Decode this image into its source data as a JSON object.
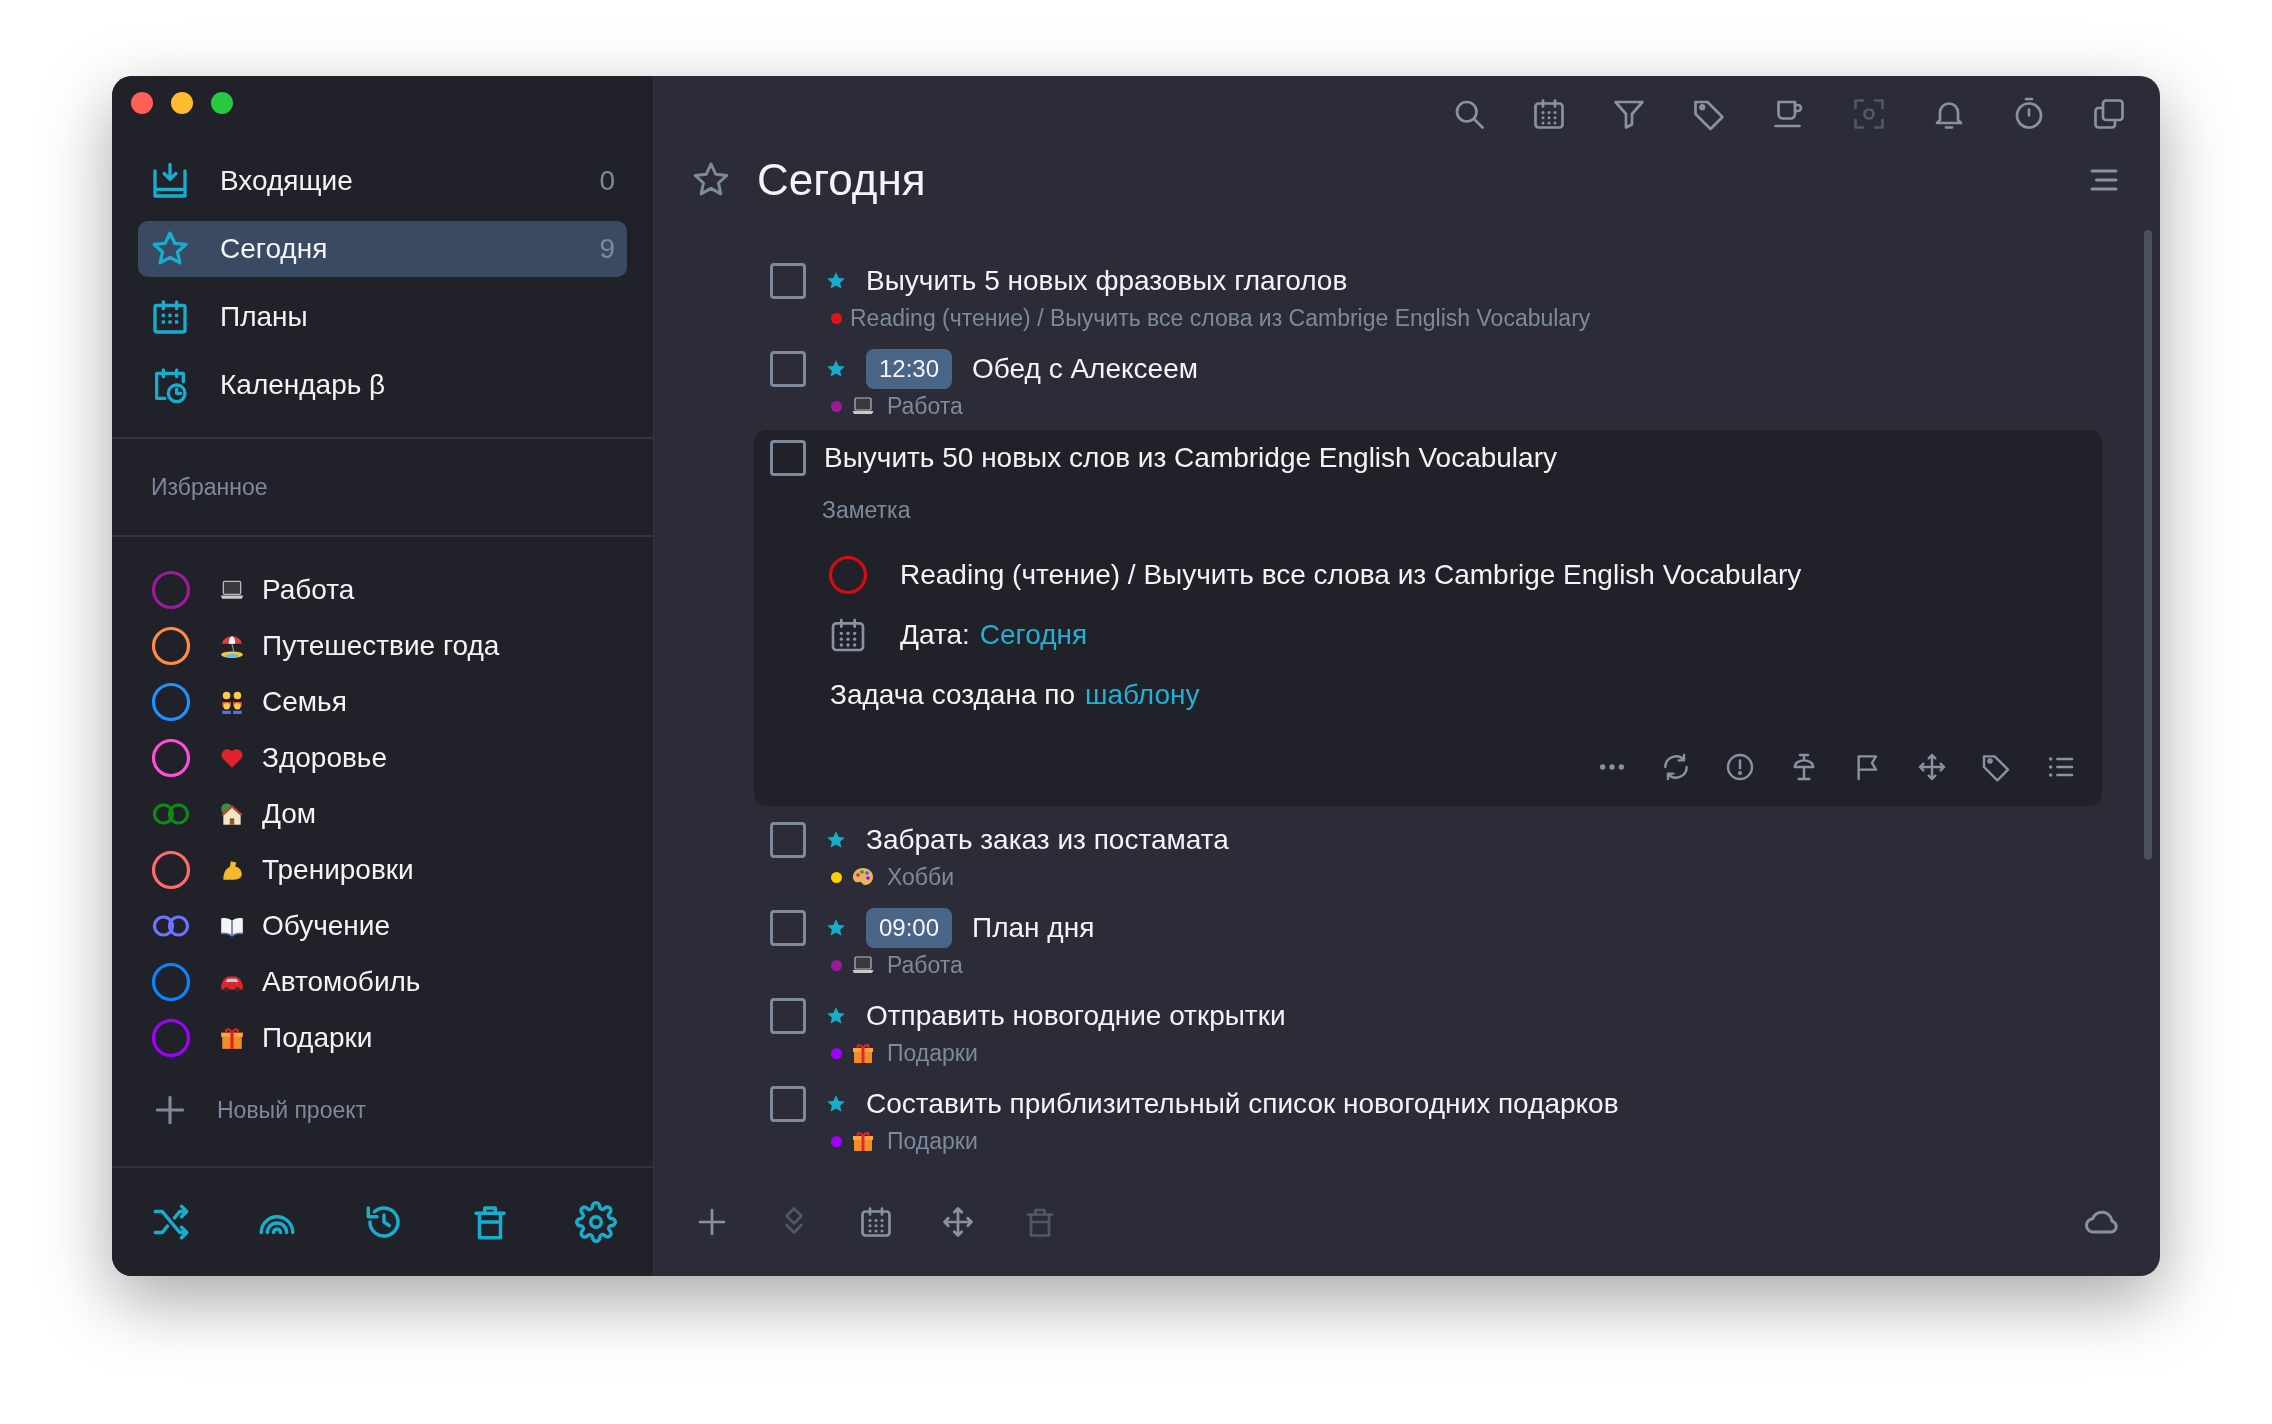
{
  "sidebar": {
    "nav": [
      {
        "kind": "inbox",
        "label": "Входящие",
        "count": "0",
        "selected": false
      },
      {
        "kind": "today",
        "label": "Сегодня",
        "count": "9",
        "selected": true
      },
      {
        "kind": "plans",
        "label": "Планы",
        "selected": false
      },
      {
        "kind": "calendar",
        "label": "Календарь β",
        "selected": false
      }
    ],
    "favorites_heading": "Избранное",
    "projects": [
      {
        "name": "Работа",
        "emoji": {
          "kind": "laptop"
        },
        "color": "#9c1a9b",
        "kind": "ring"
      },
      {
        "name": "Путешествие года",
        "emoji": {
          "kind": "beach"
        },
        "color": "#ff8c42",
        "kind": "ring"
      },
      {
        "name": "Семья",
        "emoji": {
          "kind": "family"
        },
        "color": "#1e90ff",
        "kind": "ring"
      },
      {
        "name": "Здоровье",
        "emoji": {
          "kind": "heart"
        },
        "color": "#ff4fd8",
        "kind": "ring"
      },
      {
        "name": "Дом",
        "emoji": {
          "kind": "house"
        },
        "color": "#0e8a16",
        "kind": "infinite"
      },
      {
        "name": "Тренировки",
        "emoji": {
          "kind": "arm"
        },
        "color": "#ff6a6a",
        "kind": "ring"
      },
      {
        "name": "Обучение",
        "emoji": {
          "kind": "book"
        },
        "color": "#6b73ff",
        "kind": "infinite"
      },
      {
        "name": "Автомобиль",
        "emoji": {
          "kind": "car"
        },
        "color": "#0a84ff",
        "kind": "ring"
      },
      {
        "name": "Подарки",
        "emoji": {
          "kind": "gift"
        },
        "color": "#a100ff",
        "kind": "ring"
      }
    ],
    "new_project": "Новый проект"
  },
  "toolbar": [
    {
      "kind": "search",
      "disabled": false
    },
    {
      "kind": "calendar",
      "disabled": false
    },
    {
      "kind": "filter",
      "disabled": false
    },
    {
      "kind": "tag",
      "disabled": false
    },
    {
      "kind": "cup",
      "disabled": false
    },
    {
      "kind": "focus",
      "disabled": true
    },
    {
      "kind": "bell",
      "disabled": false
    },
    {
      "kind": "timer",
      "disabled": false
    },
    {
      "kind": "copy",
      "disabled": false
    }
  ],
  "header": {
    "title": "Сегодня"
  },
  "tasks": [
    {
      "title": "Выучить 5 новых фразовых глаголов",
      "checked": false,
      "starred": true,
      "expanded": false,
      "project": {
        "name": "Reading (чтение) / Выучить все слова из Cambrige English Vocabulary",
        "color": "#e0131a"
      }
    },
    {
      "title": "Обед с Алексеем",
      "checked": false,
      "starred": true,
      "expanded": false,
      "time": "12:30",
      "project": {
        "name": "Работа",
        "color": "#9c1a9b",
        "emoji": {
          "kind": "laptop"
        }
      }
    },
    {
      "title": "Выучить 50 новых слов из Cambridge English Vocabulary",
      "checked": false,
      "starred": false,
      "expanded": true,
      "details": {
        "note_placeholder": "Заметка",
        "project": {
          "name": "Reading (чтение) / Выучить все слова из Cambrige English Vocabulary",
          "color": "#d90b12",
          "kind": "ring"
        },
        "date_label": "Дата:",
        "date_value": "Сегодня",
        "template_text": "Задача создана по",
        "template_link": "шаблону"
      }
    },
    {
      "title": "Забрать заказ из постамата",
      "checked": false,
      "starred": true,
      "expanded": false,
      "project": {
        "name": "Хобби",
        "color": "#ffcc00",
        "emoji": {
          "kind": "palette"
        }
      }
    },
    {
      "title": "План дня",
      "checked": false,
      "starred": true,
      "expanded": false,
      "time": "09:00",
      "project": {
        "name": "Работа",
        "color": "#9c1a9b",
        "emoji": {
          "kind": "laptop"
        }
      }
    },
    {
      "title": "Отправить новогодние открытки",
      "checked": false,
      "starred": true,
      "expanded": false,
      "project": {
        "name": "Подарки",
        "color": "#a100ff",
        "emoji": {
          "kind": "gift"
        }
      }
    },
    {
      "title": "Составить приблизительный список новогодних подарков",
      "checked": false,
      "starred": true,
      "expanded": false,
      "project": {
        "name": "Подарки",
        "color": "#a100ff",
        "emoji": {
          "kind": "gift"
        }
      }
    }
  ],
  "bottom_toolbar": [
    {
      "kind": "plus",
      "disabled": false
    },
    {
      "kind": "layers",
      "disabled": true
    },
    {
      "kind": "calendar",
      "disabled": false
    },
    {
      "kind": "move",
      "disabled": false
    },
    {
      "kind": "trash",
      "disabled": true
    }
  ]
}
